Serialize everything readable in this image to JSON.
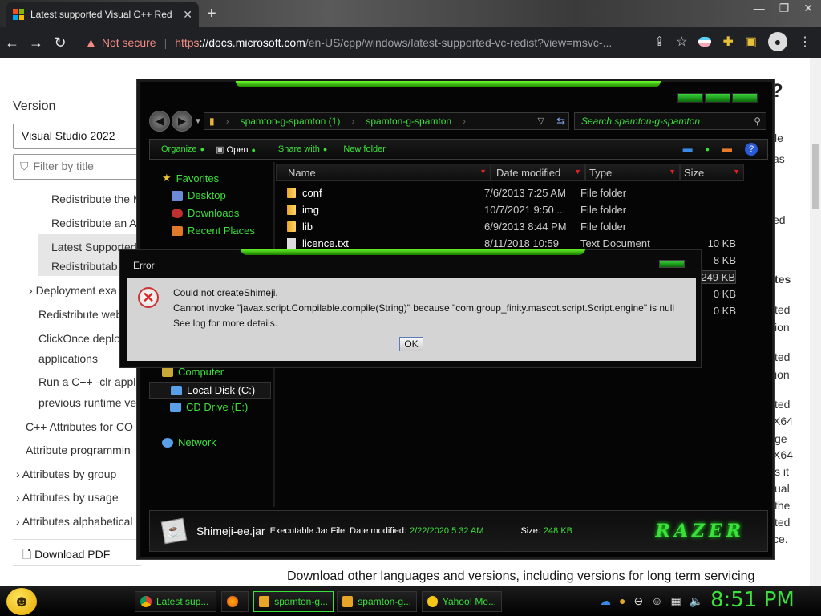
{
  "browser": {
    "tab_title": "Latest supported Visual C++ Red",
    "new_tab": "+",
    "window_controls": [
      "—",
      "❐",
      "✕"
    ],
    "not_secure": "Not secure",
    "url_scheme": "https",
    "url_host": "://docs.microsoft.com",
    "url_path": "/en-US/cpp/windows/latest-supported-vc-redist?view=msvc-..."
  },
  "docs": {
    "version_label": "Version",
    "version_value": "Visual Studio 2022",
    "filter_placeholder": "Filter by title",
    "toc": [
      "Redistribute the M",
      "Redistribute an AT",
      "Latest Supported",
      "Redistributab",
      "Deployment exa",
      "Redistribute web",
      "ClickOnce deplo",
      "applications",
      "Run a C++ -clr appl",
      "previous runtime ve",
      "C++ Attributes for CO",
      "Attribute programmin",
      "Attributes by group",
      "Attributes by usage",
      "Attributes alphabetical"
    ],
    "download_pdf": "Download PDF",
    "right_fragments": [
      "?",
      "le",
      "as",
      "ed",
      "tes",
      "ted",
      "ion",
      "ted",
      "ion",
      "ted",
      "X64",
      "ge",
      "X64",
      "s it",
      "ual",
      "the",
      "ted",
      "ce."
    ],
    "bottom_text": "Download other languages and versions, including versions for long term servicing"
  },
  "explorer": {
    "breadcrumb": [
      "spamton-g-spamton (1)",
      "spamton-g-spamton"
    ],
    "search_placeholder": "Search spamton-g-spamton",
    "commands": [
      "Organize",
      "Open",
      "Share with",
      "New folder"
    ],
    "nav": {
      "favorites": "Favorites",
      "desktop": "Desktop",
      "downloads": "Downloads",
      "recent": "Recent Places",
      "computer": "Computer",
      "local_disk": "Local Disk (C:)",
      "cd_drive": "CD Drive (E:)",
      "network": "Network"
    },
    "columns": [
      "Name",
      "Date modified",
      "Type",
      "Size"
    ],
    "files": [
      {
        "name": "conf",
        "date": "7/6/2013 7:25 AM",
        "type": "File folder",
        "size": "",
        "kind": "folder"
      },
      {
        "name": "img",
        "date": "10/7/2021 9:50 ...",
        "type": "File folder",
        "size": "",
        "kind": "folder"
      },
      {
        "name": "lib",
        "date": "6/9/2013 8:44 PM",
        "type": "File folder",
        "size": "",
        "kind": "folder"
      },
      {
        "name": "licence.txt",
        "date": "8/11/2018 10:59",
        "type": "Text Document",
        "size": "10 KB",
        "kind": "doc"
      },
      {
        "name": "",
        "date": "",
        "type": "",
        "size": "8 KB",
        "kind": "hidden"
      },
      {
        "name": "",
        "date": "",
        "type": "",
        "size": "249 KB",
        "kind": "hidden"
      },
      {
        "name": "",
        "date": "",
        "type": "",
        "size": "0 KB",
        "kind": "hidden"
      },
      {
        "name": "",
        "date": "",
        "type": "",
        "size": "0 KB",
        "kind": "hidden"
      }
    ],
    "details": {
      "file_name": "Shimeji-ee.jar",
      "file_type": "Executable Jar File",
      "date_label": "Date modified:",
      "date_value": "2/22/2020 5:32 AM",
      "size_label": "Size:",
      "size_value": "248 KB",
      "logo_text": "RAZER"
    }
  },
  "error_dialog": {
    "title": "Error",
    "line1": "Could not createShimeji.",
    "line2": "Cannot invoke \"javax.script.Compilable.compile(String)\" because \"com.group_finity.mascot.script.Script.engine\" is null",
    "line3": "See log for more details.",
    "ok": "OK"
  },
  "taskbar": {
    "items": [
      "Latest sup...",
      "",
      "spamton-g...",
      "spamton-g...",
      "Yahoo! Me..."
    ],
    "clock": "8:51 PM"
  },
  "colors": {
    "razer_green": "#3be03b",
    "error_red": "#f28b82"
  }
}
